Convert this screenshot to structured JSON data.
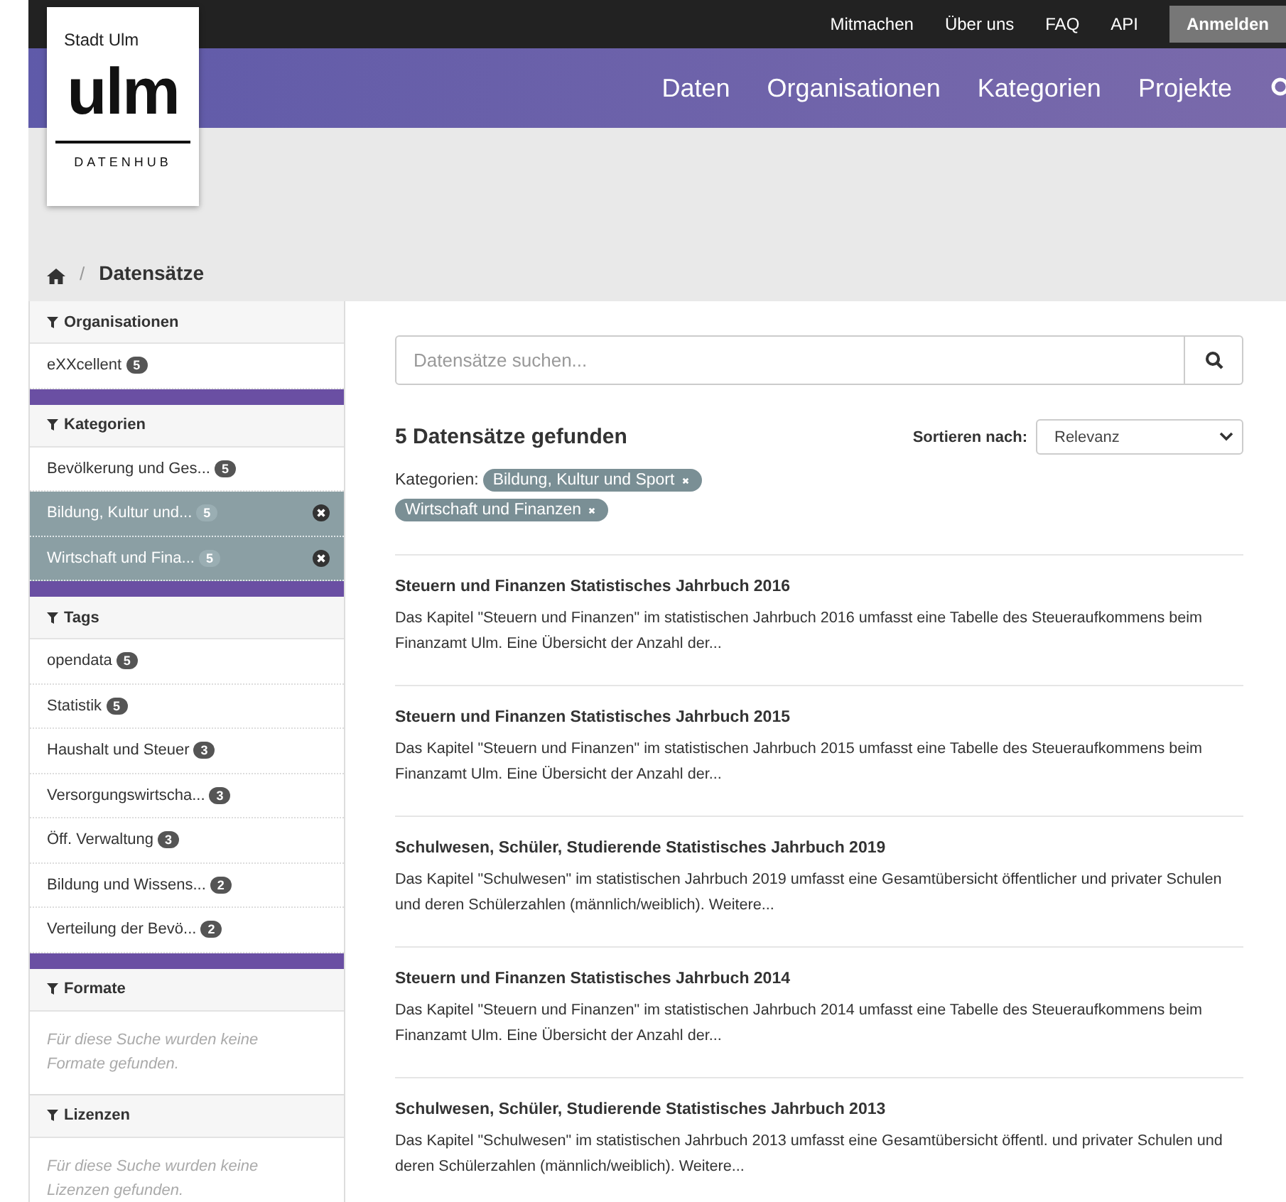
{
  "logo": {
    "city": "Stadt Ulm",
    "mark": "ulm",
    "subtitle": "DATENHUB"
  },
  "top_links": [
    "Mitmachen",
    "Über uns",
    "FAQ",
    "API"
  ],
  "login": "Anmelden",
  "nav": [
    "Daten",
    "Organisationen",
    "Kategorien",
    "Projekte"
  ],
  "breadcrumb_separator": "/",
  "breadcrumb": "Datensätze",
  "facets": [
    {
      "kind": "list",
      "title": "Organisationen",
      "items": [
        {
          "label": "eXXcellent",
          "count": "5",
          "selected": false
        }
      ]
    },
    {
      "kind": "list",
      "title": "Kategorien",
      "items": [
        {
          "label": "Bevölkerung und Ges...",
          "count": "5",
          "selected": false
        },
        {
          "label": "Bildung, Kultur und...",
          "count": "5",
          "selected": true
        },
        {
          "label": "Wirtschaft und Fina...",
          "count": "5",
          "selected": true
        }
      ]
    },
    {
      "kind": "list",
      "title": "Tags",
      "items": [
        {
          "label": "opendata",
          "count": "5",
          "selected": false
        },
        {
          "label": "Statistik",
          "count": "5",
          "selected": false
        },
        {
          "label": "Haushalt und Steuer",
          "count": "3",
          "selected": false
        },
        {
          "label": "Versorgungswirtscha...",
          "count": "3",
          "selected": false
        },
        {
          "label": "Öff. Verwaltung",
          "count": "3",
          "selected": false
        },
        {
          "label": "Bildung und Wissens...",
          "count": "2",
          "selected": false
        },
        {
          "label": "Verteilung der Bevö...",
          "count": "2",
          "selected": false
        }
      ]
    },
    {
      "kind": "empty",
      "title": "Formate",
      "message": "Für diese Suche wurden keine Formate gefunden."
    },
    {
      "kind": "empty",
      "title": "Lizenzen",
      "message": "Für diese Suche wurden keine Lizenzen gefunden."
    }
  ],
  "search": {
    "placeholder": "Datensätze suchen..."
  },
  "result_count": "5 Datensätze gefunden",
  "sort": {
    "label": "Sortieren nach:",
    "value": "Relevanz"
  },
  "filters": {
    "label": "Kategorien:",
    "tags": [
      "Bildung, Kultur und Sport",
      "Wirtschaft und Finanzen"
    ]
  },
  "datasets": [
    {
      "title": "Steuern und Finanzen Statistisches Jahrbuch 2016",
      "description": "Das Kapitel \"Steuern und Finanzen\" im statistischen Jahrbuch 2016 umfasst eine Tabelle des Steueraufkommens beim Finanzamt Ulm. Eine Übersicht der Anzahl der..."
    },
    {
      "title": "Steuern und Finanzen Statistisches Jahrbuch 2015",
      "description": "Das Kapitel \"Steuern und Finanzen\" im statistischen Jahrbuch 2015 umfasst eine Tabelle des Steueraufkommens beim Finanzamt Ulm. Eine Übersicht der Anzahl der..."
    },
    {
      "title": "Schulwesen, Schüler, Studierende Statistisches Jahrbuch 2019",
      "description": "Das Kapitel \"Schulwesen\" im statistischen Jahrbuch 2019 umfasst eine Gesamtübersicht öffentlicher und privater Schulen und deren Schülerzahlen (männlich/weiblich). Weitere..."
    },
    {
      "title": "Steuern und Finanzen Statistisches Jahrbuch 2014",
      "description": "Das Kapitel \"Steuern und Finanzen\" im statistischen Jahrbuch 2014 umfasst eine Tabelle des Steueraufkommens beim Finanzamt Ulm. Eine Übersicht der Anzahl der..."
    },
    {
      "title": "Schulwesen, Schüler, Studierende Statistisches Jahrbuch 2013",
      "description": "Das Kapitel \"Schulwesen\" im statistischen Jahrbuch 2013 umfasst eine Gesamtübersicht öffentl. und privater Schulen und deren Schülerzahlen (männlich/weiblich). Weitere..."
    }
  ]
}
